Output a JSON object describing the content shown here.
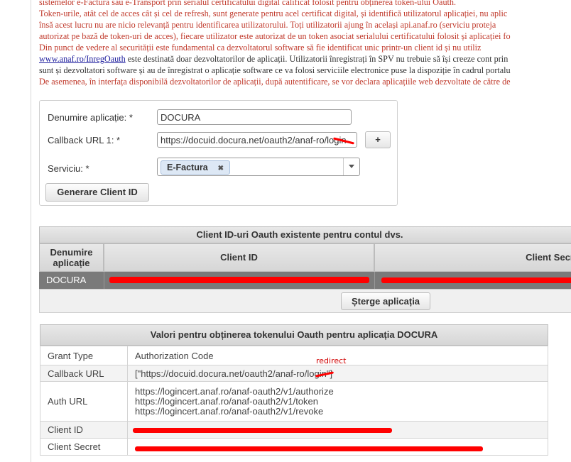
{
  "intro": {
    "line1": "sistemelor e-Factura sau e-Transport prin serialul certificatului digital calificat folosit pentru obținerea token-ului Oauth.",
    "line2": "Token-urile, atât cel de acces cât și cel de refresh, sunt generate pentru acel certificat digital, și identifică utilizatorul aplicației, nu aplic",
    "line3": "însă acest lucru nu are nicio relevanță pentru identificarea utilizatorului. Toți utilizatorii ajung în același api.anaf.ro (serviciu proteja",
    "line4": "autorizat pe bază de token-uri de acces), fiecare utilizator este autorizat de un token asociat serialului certificatului folosit și aplicației fo",
    "line5": "Din punct de vedere al securității este fundamental ca dezvoltatorul software să fie identificat unic printr-un client id și nu utiliz",
    "line6_link": "www.anaf.ro/InregOauth",
    "line6_rest": " este destinată doar dezvoltatorilor de aplicații. Utilizatorii înregistrați în SPV nu trebuie să își creeze cont prin",
    "line7": "sunt și dezvoltatori software și au de înregistrat o aplicație software ce va folosi serviciile electronice puse la dispoziție în cadrul portalu",
    "line8": "De asemenea, în interfața disponibilă dezvoltatorilor de aplicații, după autentificare, se vor declara aplicațiile web dezvoltate de către de"
  },
  "form": {
    "app_name_label": "Denumire aplicație: *",
    "app_name_value": "DOCURA",
    "callback_label": "Callback URL 1: *",
    "callback_value": "https://docuid.docura.net/oauth2/anaf-ro/login",
    "add_label": "+",
    "service_label": "Serviciu: *",
    "service_tag": "E-Factura",
    "service_tag_remove": "✖",
    "generate_label": "Generare Client ID"
  },
  "clients": {
    "title": "Client ID-uri Oauth existente pentru contul dvs.",
    "col_name": "Denumire aplicație",
    "col_id": "Client ID",
    "col_secret": "Client Secr",
    "row_name": "DOCURA",
    "delete_label": "Șterge aplicația"
  },
  "token": {
    "title": "Valori pentru obținerea tokenului Oauth pentru aplicația DOCURA",
    "annotation": "redirect",
    "rows": [
      {
        "key": "Grant Type",
        "value": "Authorization Code"
      },
      {
        "key": "Callback URL",
        "value": "[\"https://docuid.docura.net/oauth2/anaf-ro/login\"]"
      },
      {
        "key": "Auth URL",
        "lines": [
          "https://logincert.anaf.ro/anaf-oauth2/v1/authorize",
          "https://logincert.anaf.ro/anaf-oauth2/v1/token",
          "https://logincert.anaf.ro/anaf-oauth2/v1/revoke"
        ]
      },
      {
        "key": "Client ID",
        "value": ""
      },
      {
        "key": "Client Secret",
        "value": ""
      }
    ]
  },
  "colors": {
    "intro_text": "#c0392b",
    "link": "#1a1a9c",
    "redaction": "#ff0000",
    "tag_bg": "#dde8f5",
    "selected_row": "#7a7a7a"
  }
}
